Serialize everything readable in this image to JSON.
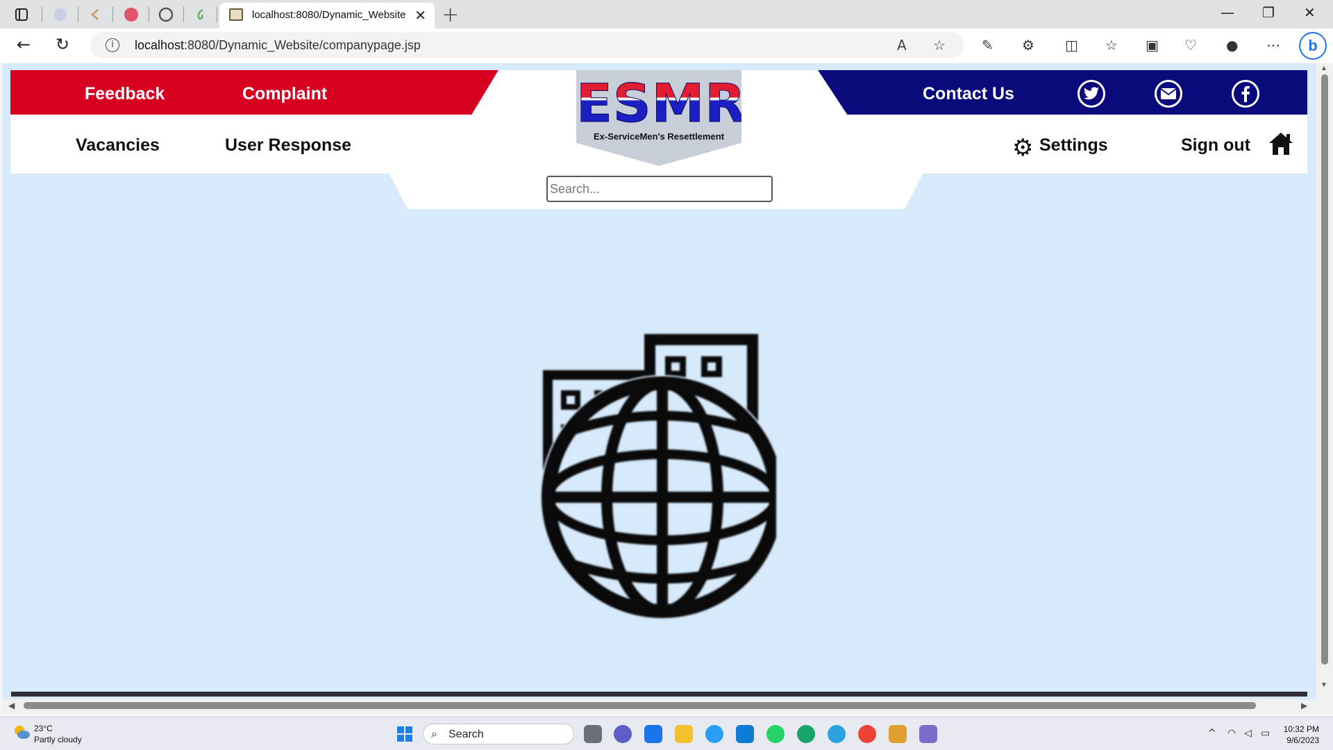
{
  "browser": {
    "active_tab_title": "localhost:8080/Dynamic_Website",
    "url_host": "localhost",
    "url_rest": ":8080/Dynamic_Website/companypage.jsp"
  },
  "site": {
    "top_left_links": [
      "Feedback",
      "Complaint"
    ],
    "contact_label": "Contact Us",
    "social_icons": [
      "twitter-icon",
      "mail-icon",
      "facebook-icon"
    ],
    "nav_left": [
      "Vacancies",
      "User Response"
    ],
    "settings_label": "Settings",
    "signout_label": "Sign out",
    "logo": {
      "title": "ESMR",
      "subtitle": "Ex-ServiceMen's Resettlement"
    },
    "search_placeholder": "Search...",
    "colors": {
      "red_bar": "#d80021",
      "blue_bar": "#0b0a7d",
      "page_bg": "#d6eafb"
    }
  },
  "taskbar": {
    "weather_temp": "23°C",
    "weather_desc": "Partly cloudy",
    "search_label": "Search",
    "time": "10:32 PM",
    "date": "9/6/2023"
  }
}
